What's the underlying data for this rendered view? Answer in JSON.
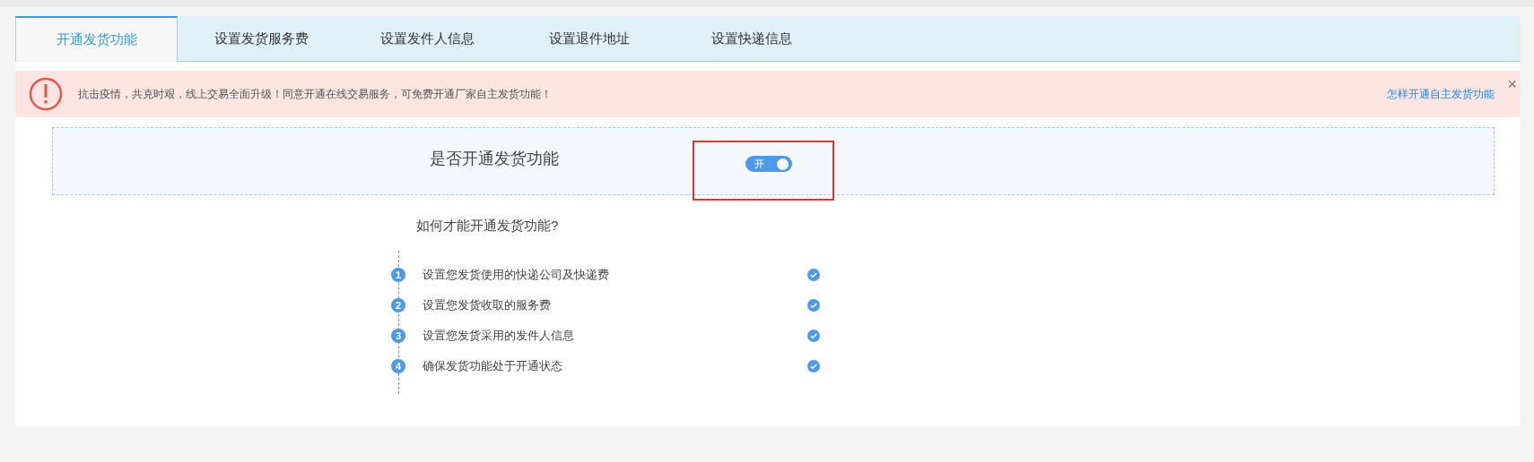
{
  "tabs": [
    {
      "label": "开通发货功能",
      "selected": true
    },
    {
      "label": "设置发货服务费",
      "selected": false
    },
    {
      "label": "设置发件人信息",
      "selected": false
    },
    {
      "label": "设置退件地址",
      "selected": false
    },
    {
      "label": "设置快递信息",
      "selected": false
    }
  ],
  "alert": {
    "message": "抗击疫情，共克时艰，线上交易全面升级！同意开通在线交易服务，可免费开通厂家自主发货功能！",
    "link": "怎样开通自主发货功能",
    "close": "×"
  },
  "setting": {
    "label": "是否开通发货功能",
    "toggle": {
      "on": true,
      "text": "开",
      "highlighted": true
    }
  },
  "guide": {
    "question": "如何才能开通发货功能?",
    "steps": [
      {
        "number": "1",
        "text": "设置您发货使用的快递公司及快递费",
        "done": true
      },
      {
        "number": "2",
        "text": "设置您发货收取的服务费",
        "done": true
      },
      {
        "number": "3",
        "text": "设置您发货采用的发件人信息",
        "done": true
      },
      {
        "number": "4",
        "text": "确保发货功能处于开通状态",
        "done": true
      }
    ]
  }
}
